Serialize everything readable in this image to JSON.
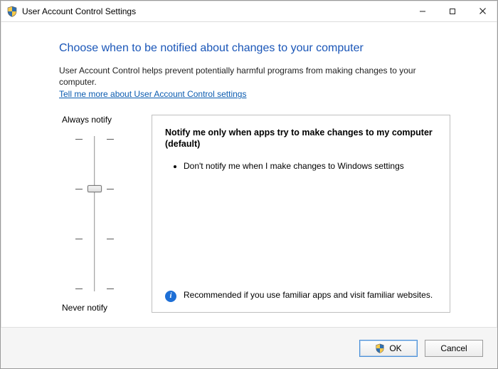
{
  "titlebar": {
    "title": "User Account Control Settings"
  },
  "heading": "Choose when to be notified about changes to your computer",
  "description": "User Account Control helps prevent potentially harmful programs from making changes to your computer.",
  "help_link": "Tell me more about User Account Control settings",
  "slider": {
    "top_label": "Always notify",
    "bottom_label": "Never notify",
    "levels": 4,
    "current_level_index": 1
  },
  "panel": {
    "title": "Notify me only when apps try to make changes to my computer (default)",
    "bullets": [
      "Don't notify me when I make changes to Windows settings"
    ],
    "recommendation": "Recommended if you use familiar apps and visit familiar websites."
  },
  "buttons": {
    "ok": "OK",
    "cancel": "Cancel"
  }
}
